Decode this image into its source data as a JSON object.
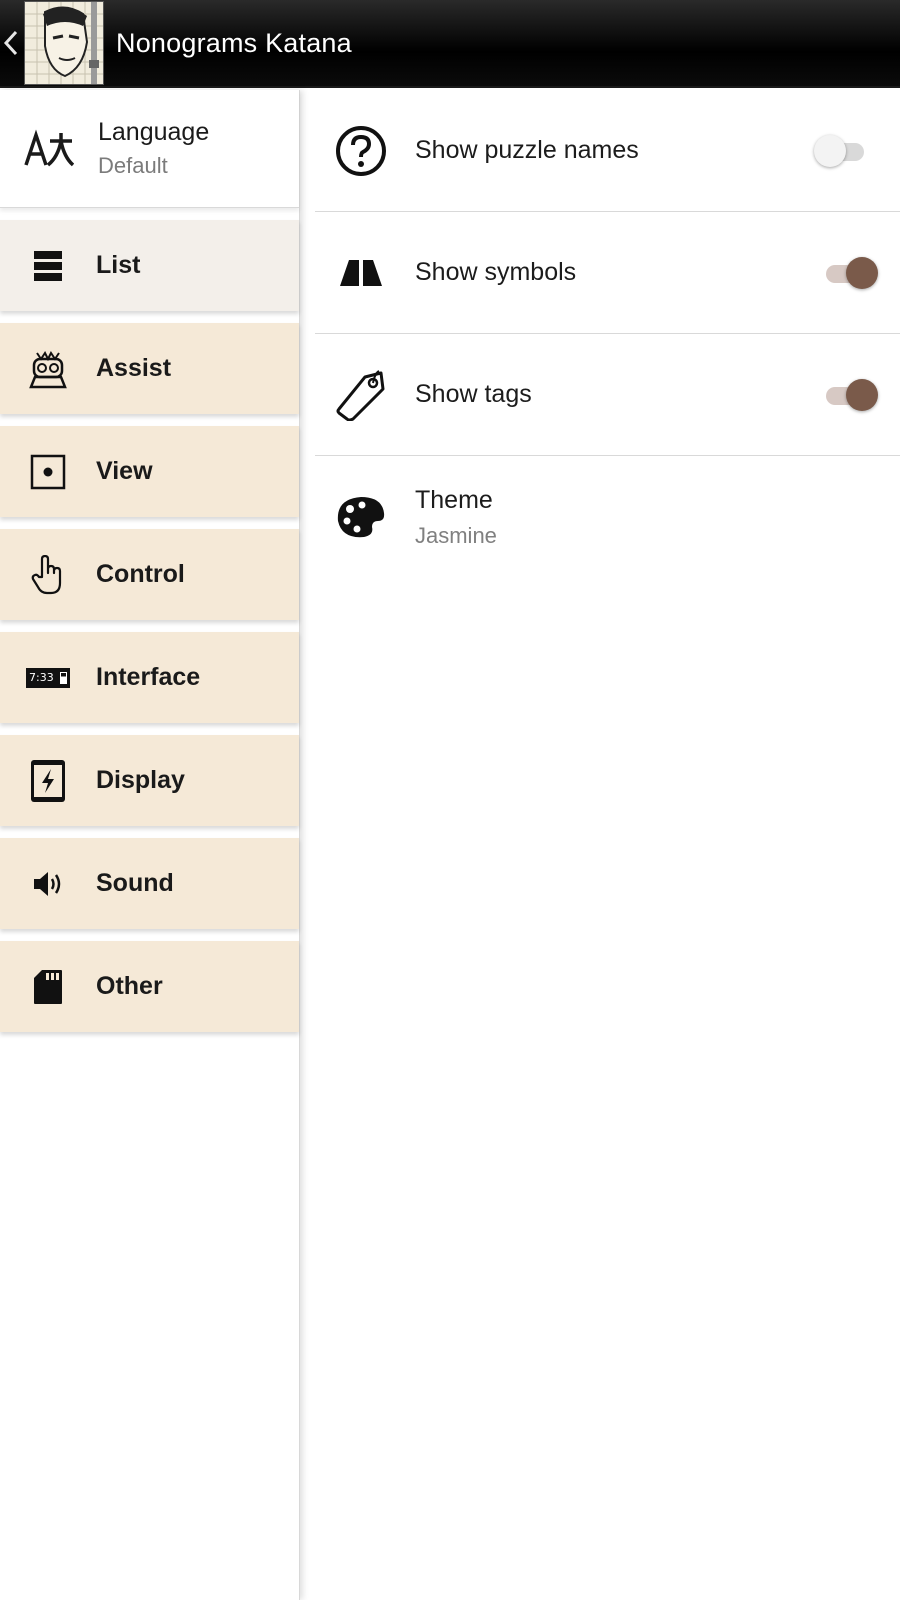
{
  "app": {
    "title": "Nonograms Katana"
  },
  "sidebar": {
    "language": {
      "title": "Language",
      "value": "Default"
    },
    "items": [
      {
        "label": "List",
        "icon": "list-icon",
        "selected": true
      },
      {
        "label": "Assist",
        "icon": "assist-robot-icon",
        "selected": false
      },
      {
        "label": "View",
        "icon": "view-dot-icon",
        "selected": false
      },
      {
        "label": "Control",
        "icon": "pointer-hand-icon",
        "selected": false
      },
      {
        "label": "Interface",
        "icon": "status-bar-icon",
        "selected": false
      },
      {
        "label": "Display",
        "icon": "phone-flash-icon",
        "selected": false
      },
      {
        "label": "Sound",
        "icon": "speaker-icon",
        "selected": false
      },
      {
        "label": "Other",
        "icon": "sd-card-icon",
        "selected": false
      }
    ],
    "interface_icon_text": "7:33"
  },
  "settings": {
    "show_puzzle_names": {
      "label": "Show puzzle names",
      "enabled": false,
      "icon": "question-circle-icon"
    },
    "show_symbols": {
      "label": "Show symbols",
      "enabled": true,
      "icon": "symbols-icon"
    },
    "show_tags": {
      "label": "Show tags",
      "enabled": true,
      "icon": "tag-icon"
    },
    "theme": {
      "label": "Theme",
      "value": "Jasmine",
      "icon": "palette-icon"
    }
  },
  "colors": {
    "category_bg": "#f5e9d7",
    "selected_bg": "#f3efea",
    "toggle_on_thumb": "#7a5a4a",
    "toggle_on_track": "#d7c9c4"
  }
}
